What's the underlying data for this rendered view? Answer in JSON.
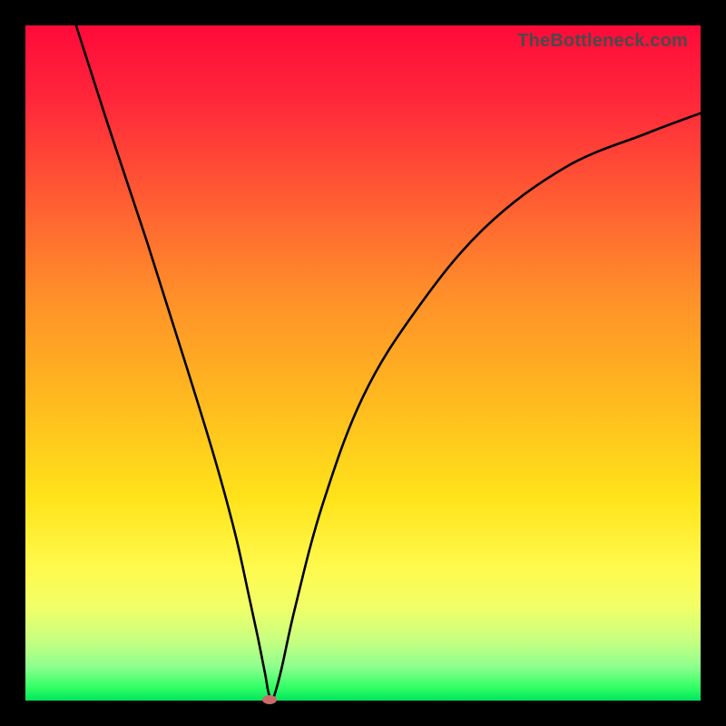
{
  "watermark": "TheBottleneck.com",
  "chart_data": {
    "type": "line",
    "title": "",
    "xlabel": "",
    "ylabel": "",
    "xlim": [
      0,
      100
    ],
    "ylim": [
      0,
      100
    ],
    "series": [
      {
        "name": "bottleneck-curve",
        "x": [
          7.5,
          12,
          18,
          24,
          28,
          31,
          33,
          34.5,
          35.5,
          36,
          36.5,
          37,
          38,
          40,
          44,
          50,
          58,
          68,
          80,
          92,
          100
        ],
        "values": [
          100,
          86,
          68,
          49,
          36,
          25,
          16,
          9,
          4,
          1.2,
          0.2,
          1.2,
          5,
          14,
          29,
          45,
          58,
          70,
          79,
          84,
          87
        ]
      }
    ],
    "marker": {
      "x": 36.2,
      "y": 0.2
    },
    "background": {
      "type": "vertical-gradient",
      "stops": [
        {
          "pos": 0.0,
          "color": "#ff0a3a"
        },
        {
          "pos": 0.25,
          "color": "#ff5a33"
        },
        {
          "pos": 0.55,
          "color": "#ffb81f"
        },
        {
          "pos": 0.8,
          "color": "#fff94c"
        },
        {
          "pos": 0.95,
          "color": "#8eff8e"
        },
        {
          "pos": 1.0,
          "color": "#00e65c"
        }
      ]
    }
  }
}
